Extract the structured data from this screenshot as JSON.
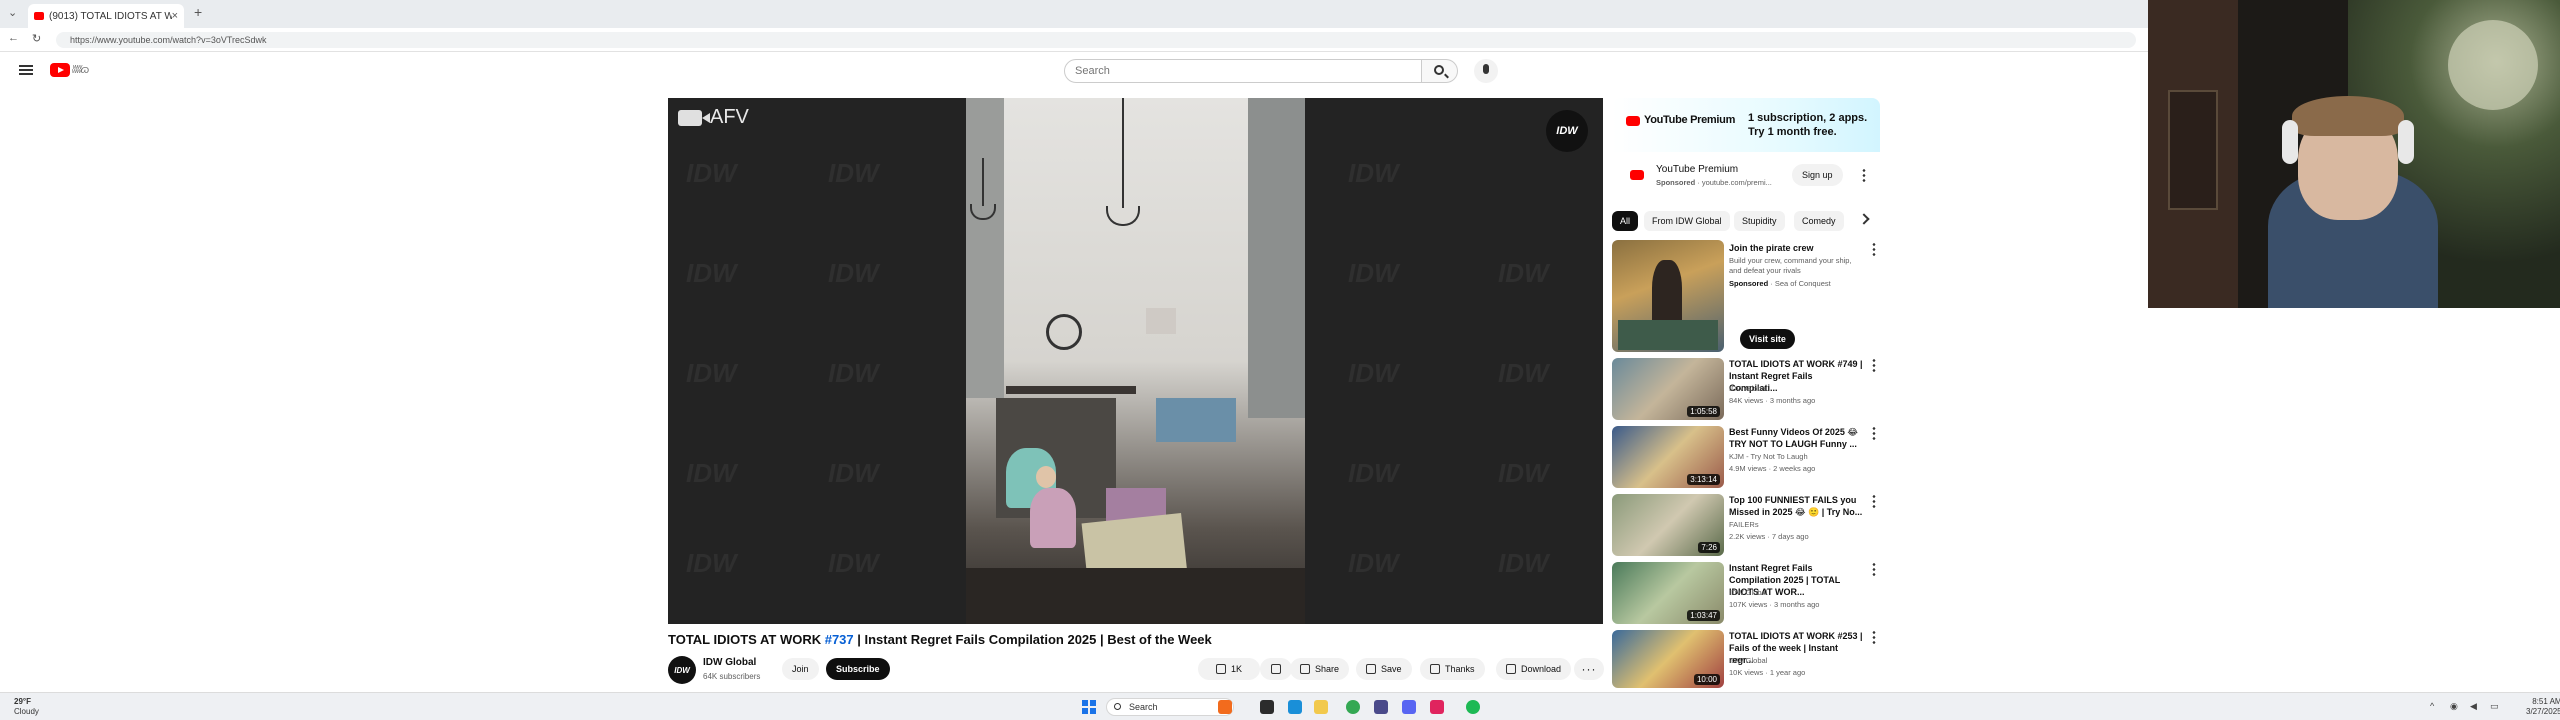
{
  "browser": {
    "tab_title": "(9013) TOTAL IDIOTS AT WOR",
    "tab_close": "×",
    "new_tab": "+",
    "tabs_dropdown": "⌄",
    "back": "←",
    "reload": "↻",
    "url": "https://www.youtube.com/watch?v=3oVTrecSdwk"
  },
  "yt": {
    "doodle_text": "ʬʬɷ",
    "search_placeholder": "Search"
  },
  "player": {
    "corner_label": "AFV",
    "badge": "IDW",
    "watermark": "IDW"
  },
  "video": {
    "title_prefix": "TOTAL IDIOTS AT WORK ",
    "title_tag": "#737",
    "title_suffix": " | Instant Regret Fails Compilation 2025 | Best of the Week",
    "channel_avatar": "IDW",
    "channel_name": "IDW Global",
    "channel_subs": "64K subscribers",
    "join": "Join",
    "subscribe": "Subscribe",
    "likes": "1K",
    "share": "Share",
    "save": "Save",
    "thanks": "Thanks",
    "download": "Download"
  },
  "ad": {
    "brand": "YouTube Premium",
    "pitch_1": "1 subscription, 2 apps.",
    "pitch_2": "Try 1 month free.",
    "row_title": "YouTube Premium",
    "row_meta_bold": "Sponsored",
    "row_meta": " · youtube.com/premi...",
    "signup": "Sign up"
  },
  "chips": [
    "All",
    "From IDW Global",
    "Stupidity",
    "Comedy"
  ],
  "promo": {
    "title": "Join the pirate crew",
    "desc": "Build your crew, command your ship, and defeat your rivals",
    "sponsored": "Sponsored",
    "advertiser": " · Sea of Conquest",
    "visit": "Visit site"
  },
  "related": [
    {
      "title": "TOTAL IDIOTS AT WORK #749 | Instant Regret Fails Compilati...",
      "channel": "IDW Global",
      "meta": "84K views · 3 months ago",
      "duration": "1:05:58"
    },
    {
      "title": "Best Funny Videos Of 2025 😂 TRY NOT TO LAUGH Funny ...",
      "channel": "KJM - Try Not To Laugh",
      "meta": "4.9M views · 2 weeks ago",
      "duration": "3:13:14"
    },
    {
      "title": "Top 100 FUNNIEST FAILS you Missed in 2025 😂 🙂 | Try No...",
      "channel": "FAILERs",
      "meta": "2.2K views · 7 days ago",
      "duration": "7:26"
    },
    {
      "title": "Instant Regret Fails Compilation 2025 | TOTAL IDIOTS AT WOR...",
      "channel": "IDW Global",
      "meta": "107K views · 3 months ago",
      "duration": "1:03:47"
    },
    {
      "title": "TOTAL IDIOTS AT WORK #253 | Fails of the week | Instant regr...",
      "channel": "IDW Global",
      "meta": "10K views · 1 year ago",
      "duration": "10:00"
    }
  ],
  "taskbar": {
    "temp": "29°F",
    "weather": "Cloudy",
    "search": "Search",
    "time": "8:51 AM",
    "date": "3/27/2025",
    "tray_chevron": "^"
  },
  "colors": {
    "yt_red": "#ff0000",
    "link_blue": "#065fd4",
    "dark": "#0f0f0f"
  }
}
